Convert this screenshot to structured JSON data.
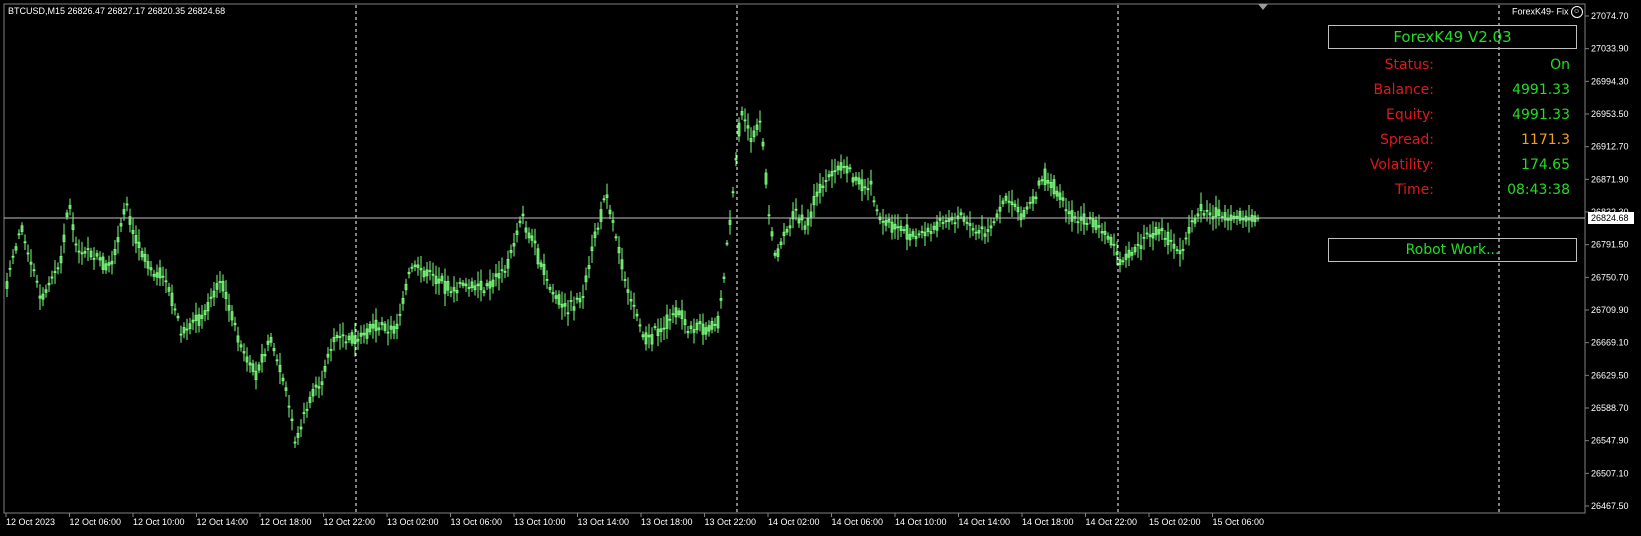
{
  "chart": {
    "symbol_line": "BTCUSD,M15  26826.47 26827.17 26820.35 26824.68",
    "current_price_label": "26824.68",
    "ea_label": "ForexK49- Fix",
    "price_ticks": [
      "27074.70",
      "27033.90",
      "26994.30",
      "26953.50",
      "26912.70",
      "26871.90",
      "26832.30",
      "26791.50",
      "26750.70",
      "26709.90",
      "26669.10",
      "26629.50",
      "26588.70",
      "26547.90",
      "26507.10",
      "26467.50"
    ],
    "time_ticks": [
      "12 Oct 2023",
      "12 Oct 06:00",
      "12 Oct 10:00",
      "12 Oct 14:00",
      "12 Oct 18:00",
      "12 Oct 22:00",
      "13 Oct 02:00",
      "13 Oct 06:00",
      "13 Oct 10:00",
      "13 Oct 14:00",
      "13 Oct 18:00",
      "13 Oct 22:00",
      "14 Oct 02:00",
      "14 Oct 06:00",
      "14 Oct 10:00",
      "14 Oct 14:00",
      "14 Oct 18:00",
      "14 Oct 22:00",
      "15 Oct 02:00",
      "15 Oct 06:00"
    ],
    "colors": {
      "candle": "#7dff7d",
      "grid": "#ffffff",
      "background": "#000000",
      "price_line": "#c0c0c0"
    }
  },
  "panel": {
    "title": "ForexK49  V2.03",
    "status_label": "Status:",
    "status_value": "On",
    "balance_label": "Balance:",
    "balance_value": "4991.33",
    "equity_label": "Equity:",
    "equity_value": "4991.33",
    "spread_label": "Spread:",
    "spread_value": "1171.3",
    "volatility_label": "Volatility:",
    "volatility_value": "174.65",
    "time_label": "Time:",
    "time_value": "08:43:38",
    "robot_status": "Robot Work...",
    "colors": {
      "label": "#e01818",
      "value": "#22dd22",
      "spread_value": "#f0a020"
    }
  }
}
